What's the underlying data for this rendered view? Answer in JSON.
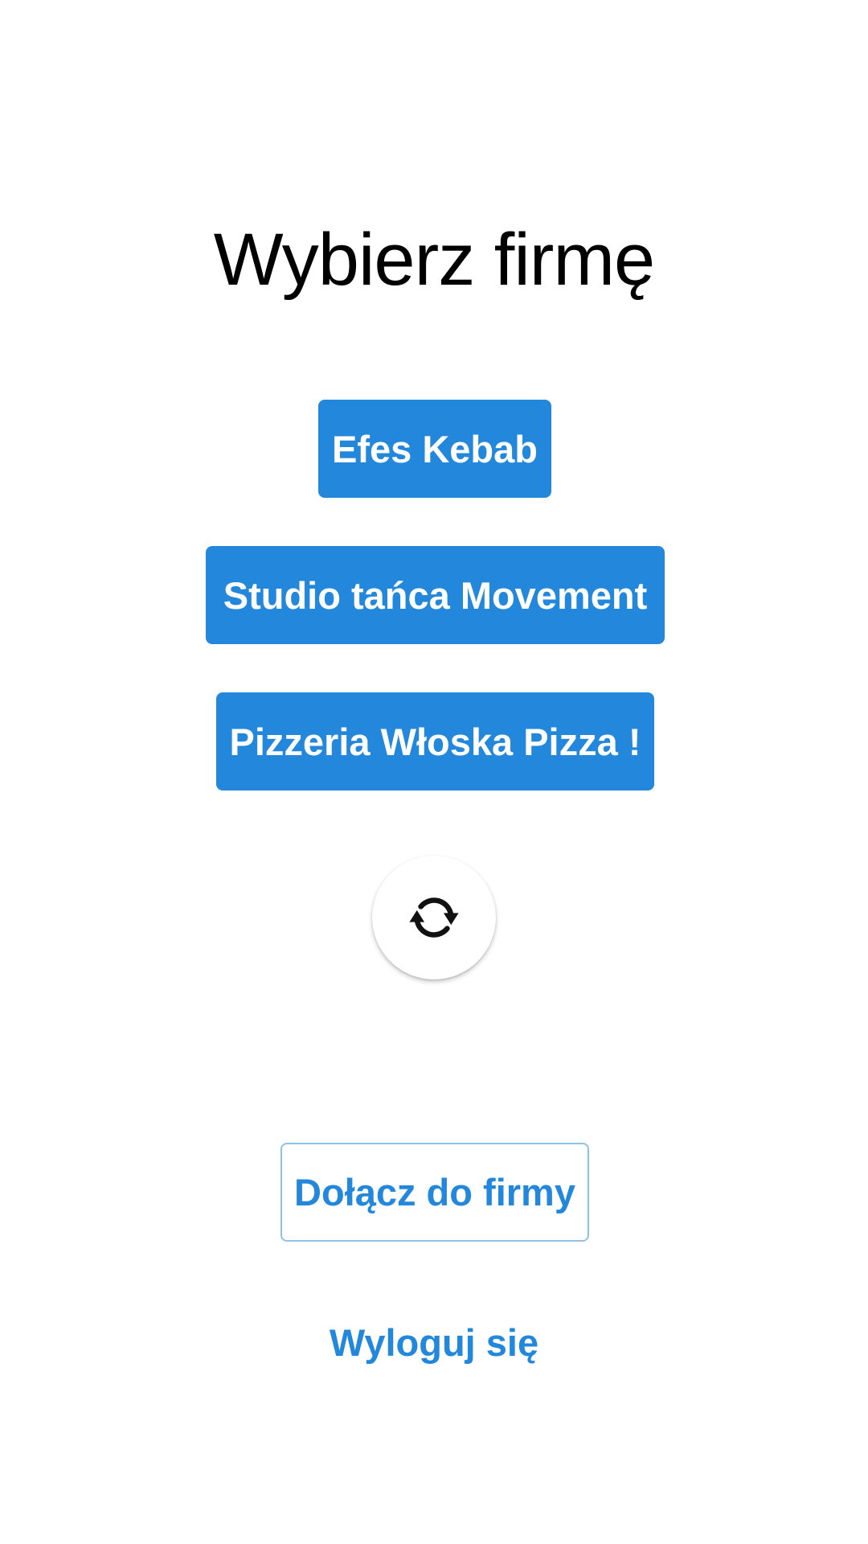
{
  "page": {
    "title": "Wybierz firmę"
  },
  "companies": [
    {
      "label": "Efes Kebab"
    },
    {
      "label": "Studio tańca Movement"
    },
    {
      "label": "Pizzeria Włoska Pizza !"
    }
  ],
  "refresh": {
    "icon": "refresh-icon"
  },
  "actions": {
    "join_label": "Dołącz do firmy",
    "logout_label": "Wyloguj się"
  },
  "colors": {
    "primary": "#2388dc",
    "outline": "#8fc1ea",
    "background": "#ffffff",
    "text": "#000000"
  }
}
